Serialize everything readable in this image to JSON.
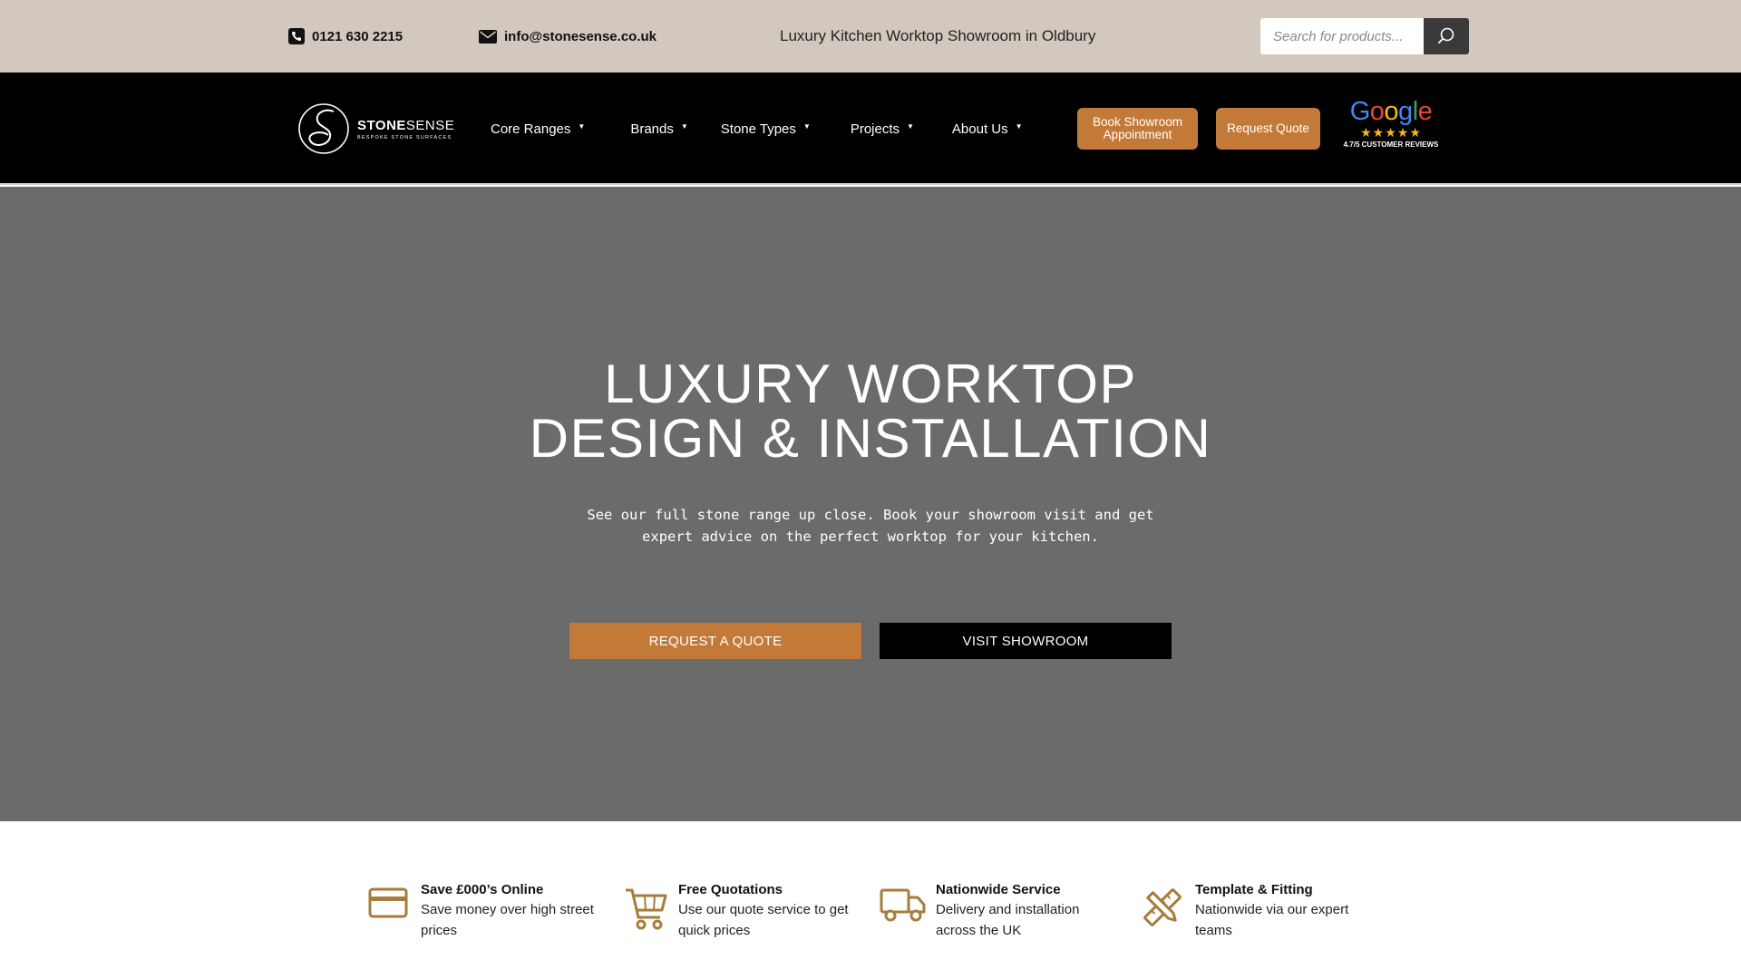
{
  "topbar": {
    "phone": "0121 630 2215",
    "email": "info@stonesense.co.uk",
    "tagline": "Luxury Kitchen Worktop Showroom in Oldbury",
    "search_placeholder": "Search for products..."
  },
  "nav": {
    "logo_name_bold": "STONE",
    "logo_name_rest": "SENSE",
    "logo_sub": "BESPOKE STONE SURFACES",
    "menu": [
      {
        "label": "Core Ranges"
      },
      {
        "label": "Brands"
      },
      {
        "label": "Stone Types"
      },
      {
        "label": "Projects"
      },
      {
        "label": "About Us"
      }
    ],
    "book_button": "Book Showroom Appointment",
    "quote_button": "Request Quote",
    "google": {
      "word": "Google",
      "stars": "★★★★★",
      "reviews": "4.7/5 CUSTOMER REVIEWS",
      "colors": {
        "blue": "#4285F4",
        "red": "#EA4335",
        "yellow": "#FBBC05",
        "green": "#34A853"
      }
    }
  },
  "hero": {
    "title_line1": "LUXURY WORKTOP",
    "title_line2": "DESIGN & INSTALLATION",
    "subtitle_line1": "See our full stone range up close. Book your showroom visit and get",
    "subtitle_line2": "expert advice on the perfect worktop for your kitchen.",
    "quote_button": "REQUEST A QUOTE",
    "visit_button": "VISIT SHOWROOM"
  },
  "features": [
    {
      "icon": "credit-card-icon",
      "title": "Save £000’s Online",
      "desc": "Save money over high street prices"
    },
    {
      "icon": "cart-icon",
      "title": "Free Quotations",
      "desc": "Use our quote service to get quick prices"
    },
    {
      "icon": "truck-icon",
      "title": "Nationwide Service",
      "desc": "Delivery and installation across the UK"
    },
    {
      "icon": "ruler-pencil-icon",
      "title": "Template & Fitting",
      "desc": "Nationwide via our expert teams"
    }
  ],
  "colors": {
    "topbar_bg": "#d2c8be",
    "accent": "#c37a39",
    "hero_bg": "#6b6b6b",
    "icon_gold": "#a77c3c"
  }
}
